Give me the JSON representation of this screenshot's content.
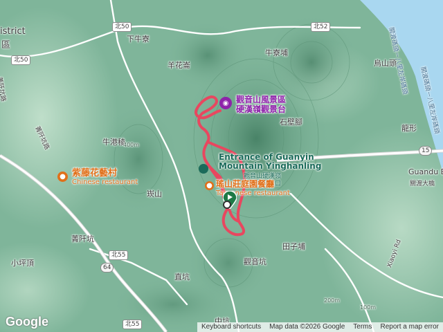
{
  "map": {
    "labels": {
      "district": "istrict",
      "district2": "區",
      "xianiuliao": "下牛寮",
      "yanghuakun": "羊花崙",
      "niuliaobu": "牛寮埔",
      "wushantou": "烏山頭",
      "shibijiao": "石壁腳",
      "longxing": "龍形",
      "niugangleng": "牛港稜",
      "chongshan": "崁山",
      "tianzibu": "田子埔",
      "guanyinkeng": "觀音坑",
      "zhikeng": "直坑",
      "xiaopingding": "小坪頂",
      "qiangankeng": "菁阡坑",
      "zhongkeng": "中坑",
      "laoqian_rd": "菁阡坑路",
      "laoqian_rd2": "菁阡坑路",
      "guandu_en": "Guandu Br",
      "guandu_zh": "關渡大橋",
      "xiaoyi_rd": "Xiaoyi Rd",
      "elev_400": "400m",
      "elev_200": "200m",
      "elev_100": "100m",
      "river_label1": "關渡碼頭－八里左岸碼頭",
      "river_label2": "關渡碼頭－八里左岸碼頭"
    },
    "shields": {
      "north50": "北50",
      "north50b": "北50",
      "north52": "北52",
      "north55": "北55",
      "north55b": "北55",
      "r64": "64",
      "r15": "15"
    },
    "pois": {
      "scenic_area_line1": "觀音山風景區",
      "scenic_area_line2": "硬漢嶺觀景台",
      "entrance_en_line1": "Entrance of Guanyin",
      "entrance_en_line2": "Mountain Yinghanling",
      "entrance_zh_line1": "觀音山硬漢嶺",
      "entrance_zh_line2": "登山步道入口",
      "restaurant_zh": "瑤山莊庭園餐廳",
      "restaurant_en": "Taiwanese restaurant",
      "zitenghua_zh": "紫藤花藝村",
      "zitenghua_en": "Chinese restaurant"
    },
    "colors": {
      "terrain": "#7fb59a",
      "track": "#e8475f",
      "river": "#a9d7f0",
      "poi_purple": "#8e24aa",
      "poi_orange": "#e0701a",
      "start_pin": "#1e7a46"
    },
    "footer": {
      "shortcuts": "Keyboard shortcuts",
      "mapdata": "Map data ©2026 Google",
      "terms": "Terms",
      "report": "Report a map error"
    },
    "logo": "Google"
  }
}
